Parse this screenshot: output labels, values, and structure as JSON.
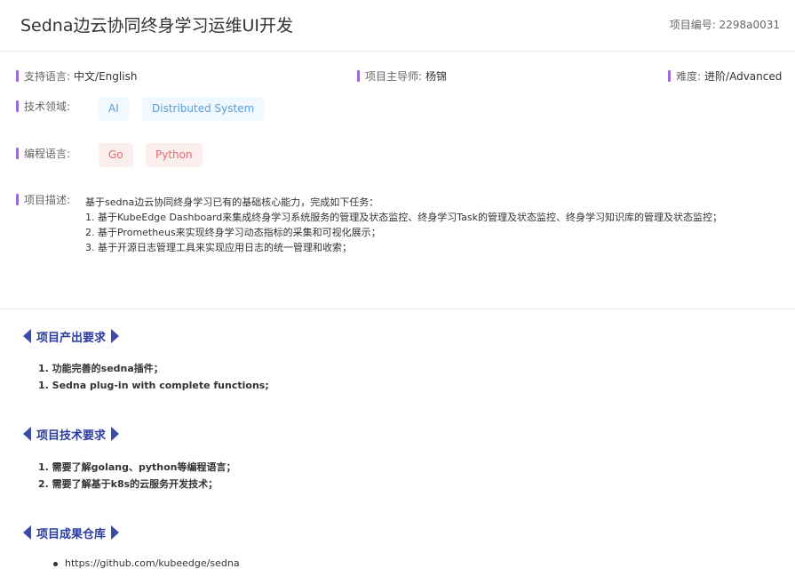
{
  "header": {
    "title": "Sedna边云协同终身学习运维UI开发",
    "project_id": "项目编号: 2298a0031"
  },
  "info": {
    "language_label": "支持语言:",
    "language_value": "中文/English",
    "mentor_label": "项目主导师:",
    "mentor_value": "杨锦",
    "difficulty_label": "难度:",
    "difficulty_value": "进阶/Advanced",
    "tech_label": "技术领域:",
    "tech_tags": [
      "AI",
      "Distributed System"
    ],
    "prog_label": "编程语言:",
    "prog_tags": [
      "Go",
      "Python"
    ],
    "desc_label": "项目描述:",
    "desc_lines": [
      "基于sedna边云协同终身学习已有的基础核心能力，完成如下任务：",
      "1. 基于KubeEdge Dashboard来集成终身学习系统服务的管理及状态监控、终身学习Task的管理及状态监控、终身学习知识库的管理及状态监控；",
      "2. 基于Prometheus来实现终身学习动态指标的采集和可视化展示；",
      "3. 基于开源日志管理工具来实现应用日志的统一管理和收索；"
    ]
  },
  "sections": {
    "output_title": "项目产出要求",
    "output_items": [
      "1. 功能完善的sedna插件；",
      "1. Sedna plug-in with complete functions;"
    ],
    "tech_req_title": "项目技术要求",
    "tech_req_items": [
      "1. 需要了解golang、python等编程语言；",
      "2. 需要了解基于k8s的云服务开发技术；"
    ],
    "repo_title": "项目成果仓库",
    "repo_url": "https://github.com/kubeedge/sedna"
  },
  "colors": {
    "accent_bar": "#9b6ad6",
    "section_title": "#2c3d9c",
    "tag_blue_bg": "#f1f8ff",
    "tag_red_bg": "#fdeeee"
  }
}
